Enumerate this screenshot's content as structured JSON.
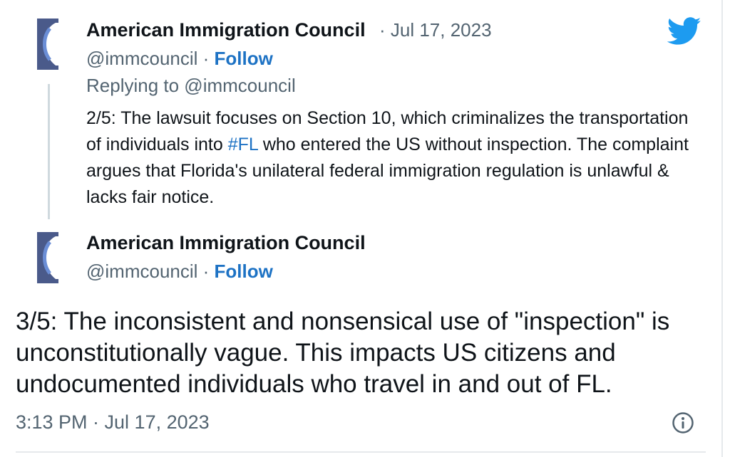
{
  "tweet_parent": {
    "author_name": "American Immigration Council",
    "date_sep": " · ",
    "date": "Jul 17, 2023",
    "handle": "@immcouncil",
    "follow_sep": " · ",
    "follow_label": "Follow",
    "replying_to": "Replying to @immcouncil",
    "text_part1": "2/5: The lawsuit focuses on Section 10, which criminalizes the transportation of individuals into ",
    "hashtag": "#FL",
    "text_part2": " who entered the US without inspection. The complaint argues that Florida's unilateral federal immigration regulation is unlawful & lacks fair notice."
  },
  "tweet_main": {
    "author_name": "American Immigration Council",
    "handle": "@immcouncil",
    "follow_sep": " · ",
    "follow_label": "Follow",
    "text": "3/5: The inconsistent and nonsensical use of \"inspection\" is unconstitutionally vague. This impacts US citizens and undocumented individuals who travel in and out of FL.",
    "timestamp": "3:13 PM · Jul 17, 2023"
  },
  "icons": {
    "brand": "twitter-bird-icon",
    "avatar": "organization-logo-icon",
    "info": "info-icon"
  },
  "colors": {
    "link": "#1d72c4",
    "twitter_blue": "#1d9bf0",
    "secondary_text": "#536471"
  }
}
